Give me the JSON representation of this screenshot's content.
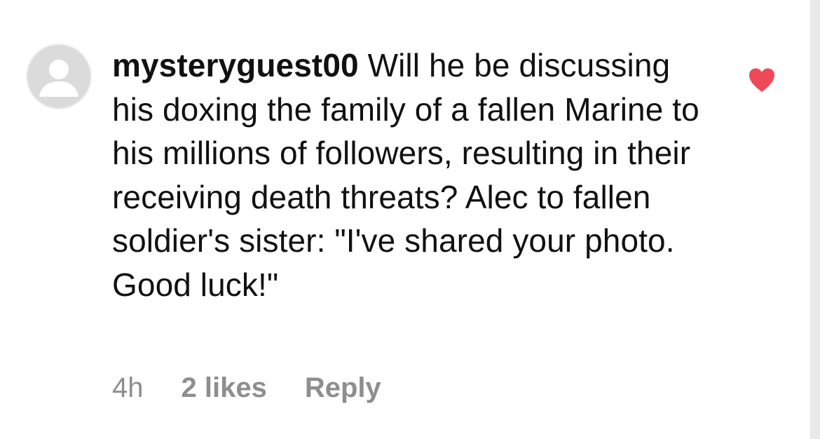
{
  "comment": {
    "username": "mysteryguest00",
    "text": "Will he be discussing his doxing the family of a fallen Marine to his millions of followers, resulting in their receiving death threats? Alec to fallen soldier's sister: \"I've shared your photo. Good luck!\"",
    "timestamp": "4h",
    "likes": "2 likes",
    "reply_label": "Reply"
  },
  "icons": {
    "avatar": "default-avatar-icon",
    "like": "heart-icon"
  },
  "colors": {
    "heart": "#ed4956",
    "meta_text": "#8e8e8e",
    "avatar_bg": "#dbdbdb"
  }
}
